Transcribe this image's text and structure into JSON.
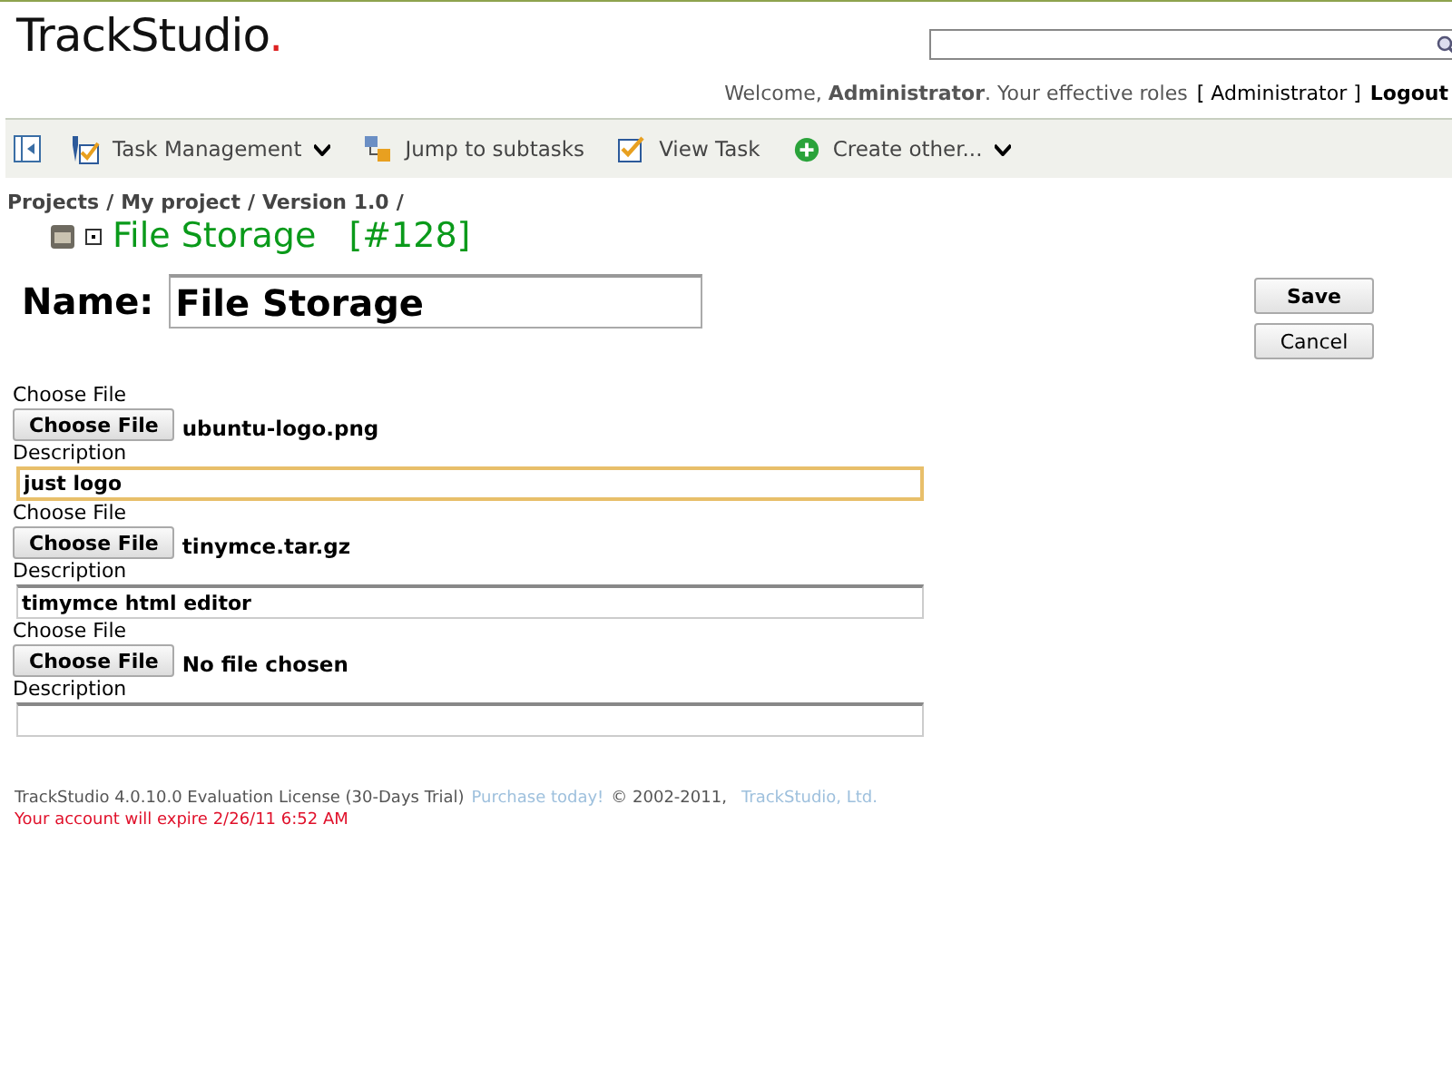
{
  "logo": {
    "name": "TrackStudio",
    "mark": "."
  },
  "welcome": {
    "greeting": "Welcome, **Administrator**. Your effective roles",
    "roles": "[ Administrator ]",
    "logout": "Logout"
  },
  "toolbar": [
    {
      "kind": "panel"
    },
    {
      "kind": "tools",
      "label": "Task Management",
      "menu": true
    },
    {
      "kind": "subtasks",
      "label": "Jump to subtasks",
      "menu": false
    },
    {
      "kind": "view",
      "label": "View Task",
      "menu": false
    },
    {
      "kind": "create",
      "label": "Create other...",
      "menu": true
    }
  ],
  "breadcrumb": [
    {
      "label": "Projects",
      "separator": "/"
    },
    {
      "label": "My project",
      "separator": "/"
    },
    {
      "label": "Version 1.0",
      "separator": "/"
    }
  ],
  "task": {
    "title": "File Storage",
    "number": "[#128]"
  },
  "name_field": {
    "label": "Name:",
    "value": "File Storage"
  },
  "buttons": [
    "Save",
    "Cancel"
  ],
  "uploads": [
    {
      "label": "Choose File",
      "button": "Choose File",
      "file": "ubuntu-logo.png",
      "description_label": "Description",
      "description": "just logo",
      "focused": true
    },
    {
      "label": "Choose File",
      "button": "Choose File",
      "file": "tinymce.tar.gz",
      "description_label": "Description",
      "description": "timymce html editor",
      "focused": false
    },
    {
      "label": "Choose File",
      "button": "Choose File",
      "file": "No file chosen",
      "description_label": "Description",
      "focused": false
    }
  ],
  "footer": {
    "license": "TrackStudio 4.0.10.0 Evaluation License (30-Days Trial)",
    "purchase": "Purchase today!",
    "copyright": "© 2002-2011,",
    "company": "TrackStudio, Ltd.",
    "expiry": "Your account will expire 2/26/11 6:52 AM"
  }
}
